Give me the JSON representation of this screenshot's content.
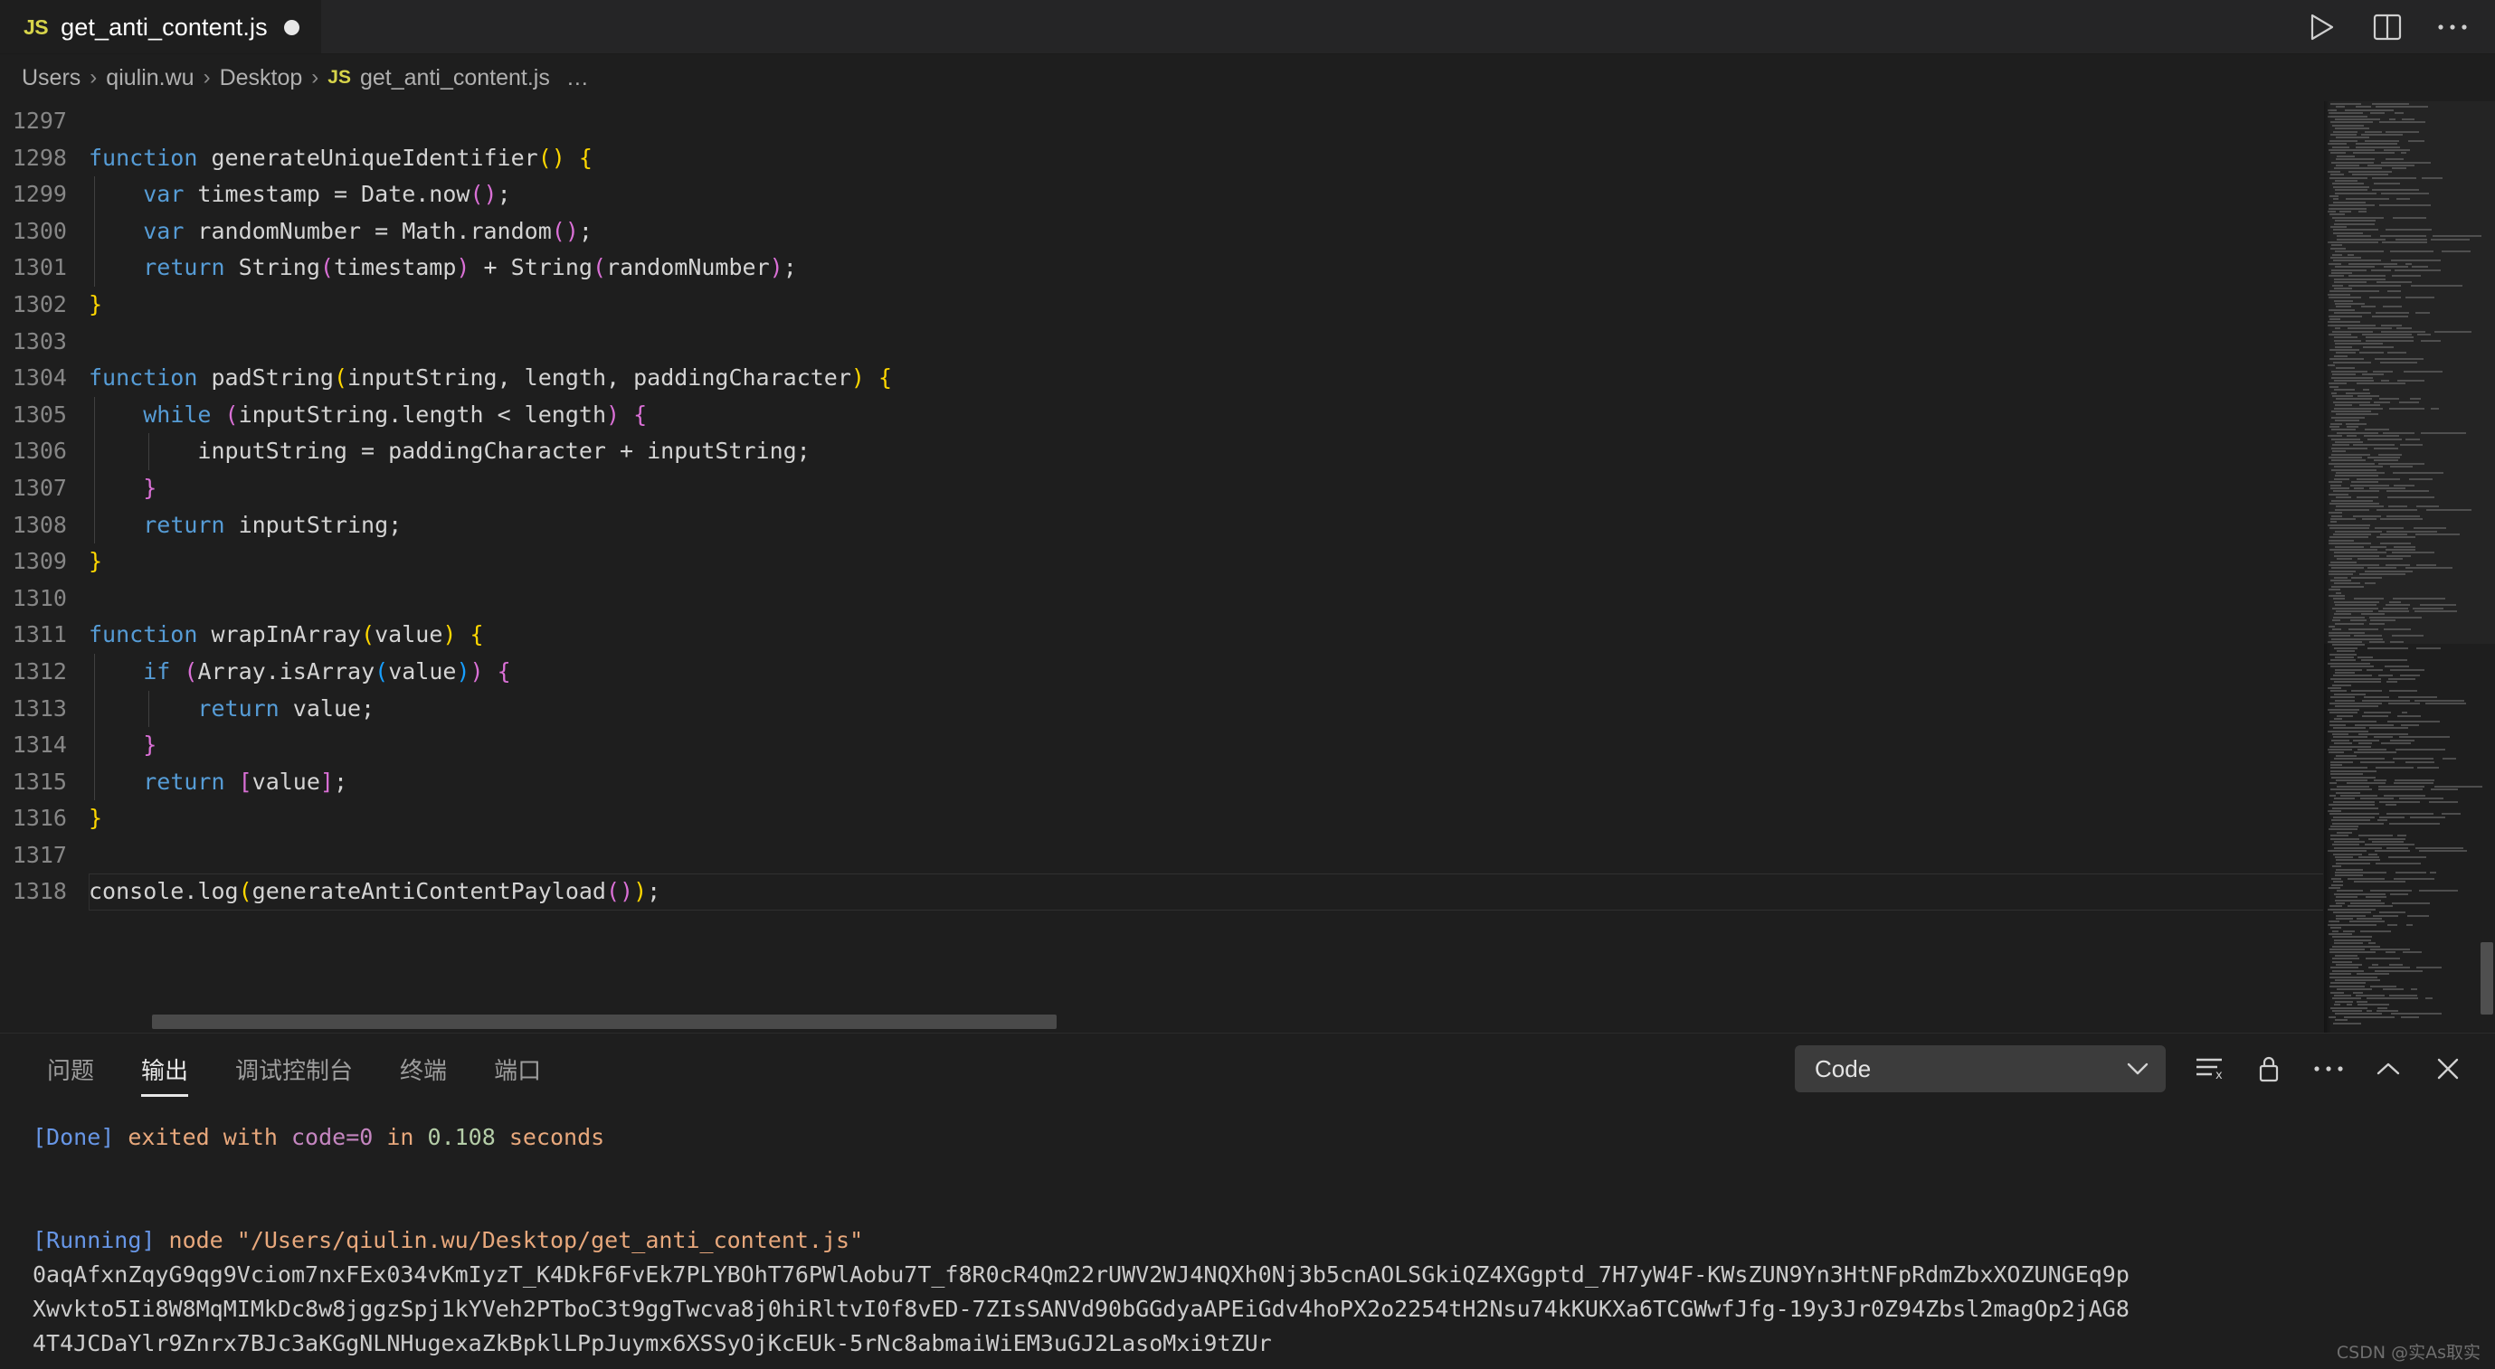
{
  "window": {
    "tab": {
      "icon": "js-file-icon",
      "label": "get_anti_content.js",
      "dirty_indicator": "●"
    },
    "actions": [
      {
        "name": "run-button",
        "glyph": "run-triangle-icon"
      },
      {
        "name": "split-editor-button",
        "glyph": "split-editor-icon"
      },
      {
        "name": "more-actions-button",
        "glyph": "ellipsis-icon"
      }
    ]
  },
  "breadcrumb": {
    "separator": "›",
    "items": [
      "Users",
      "qiulin.wu",
      "Desktop"
    ],
    "file": {
      "badge": "JS",
      "label": "get_anti_content.js"
    },
    "ellipsis": "…"
  },
  "editor": {
    "first_line_number": 1297,
    "current_line": 1318,
    "lines": [
      {
        "n": 1297,
        "tokens": []
      },
      {
        "n": 1298,
        "tokens": [
          {
            "t": "function",
            "c": "kw"
          },
          {
            "t": " ",
            "c": "punc"
          },
          {
            "t": "generateUniqueIdentifier",
            "c": "id"
          },
          {
            "t": "(",
            "c": "b1"
          },
          {
            "t": ")",
            "c": "b1"
          },
          {
            "t": " ",
            "c": "punc"
          },
          {
            "t": "{",
            "c": "b1"
          }
        ]
      },
      {
        "n": 1299,
        "indent": 1,
        "tokens": [
          {
            "t": "    ",
            "c": "punc"
          },
          {
            "t": "var",
            "c": "kw"
          },
          {
            "t": " timestamp = Date.now",
            "c": "id"
          },
          {
            "t": "(",
            "c": "b2"
          },
          {
            "t": ")",
            "c": "b2"
          },
          {
            "t": ";",
            "c": "punc"
          }
        ]
      },
      {
        "n": 1300,
        "indent": 1,
        "tokens": [
          {
            "t": "    ",
            "c": "punc"
          },
          {
            "t": "var",
            "c": "kw"
          },
          {
            "t": " randomNumber = Math.random",
            "c": "id"
          },
          {
            "t": "(",
            "c": "b2"
          },
          {
            "t": ")",
            "c": "b2"
          },
          {
            "t": ";",
            "c": "punc"
          }
        ]
      },
      {
        "n": 1301,
        "indent": 1,
        "tokens": [
          {
            "t": "    ",
            "c": "punc"
          },
          {
            "t": "return",
            "c": "kw"
          },
          {
            "t": " String",
            "c": "id"
          },
          {
            "t": "(",
            "c": "b2"
          },
          {
            "t": "timestamp",
            "c": "id"
          },
          {
            "t": ")",
            "c": "b2"
          },
          {
            "t": " + ",
            "c": "id"
          },
          {
            "t": "String",
            "c": "id"
          },
          {
            "t": "(",
            "c": "b2"
          },
          {
            "t": "randomNumber",
            "c": "id"
          },
          {
            "t": ")",
            "c": "b2"
          },
          {
            "t": ";",
            "c": "punc"
          }
        ]
      },
      {
        "n": 1302,
        "tokens": [
          {
            "t": "}",
            "c": "b1"
          }
        ]
      },
      {
        "n": 1303,
        "tokens": []
      },
      {
        "n": 1304,
        "tokens": [
          {
            "t": "function",
            "c": "kw"
          },
          {
            "t": " ",
            "c": "punc"
          },
          {
            "t": "padString",
            "c": "id"
          },
          {
            "t": "(",
            "c": "b1"
          },
          {
            "t": "inputString, length, paddingCharacter",
            "c": "id"
          },
          {
            "t": ")",
            "c": "b1"
          },
          {
            "t": " ",
            "c": "punc"
          },
          {
            "t": "{",
            "c": "b1"
          }
        ]
      },
      {
        "n": 1305,
        "indent": 1,
        "tokens": [
          {
            "t": "    ",
            "c": "punc"
          },
          {
            "t": "while",
            "c": "kw"
          },
          {
            "t": " ",
            "c": "punc"
          },
          {
            "t": "(",
            "c": "b2"
          },
          {
            "t": "inputString.length < length",
            "c": "id"
          },
          {
            "t": ")",
            "c": "b2"
          },
          {
            "t": " ",
            "c": "punc"
          },
          {
            "t": "{",
            "c": "b2"
          }
        ]
      },
      {
        "n": 1306,
        "indent": 2,
        "tokens": [
          {
            "t": "        inputString = paddingCharacter + inputString;",
            "c": "id"
          }
        ]
      },
      {
        "n": 1307,
        "indent": 1,
        "tokens": [
          {
            "t": "    ",
            "c": "punc"
          },
          {
            "t": "}",
            "c": "b2"
          }
        ]
      },
      {
        "n": 1308,
        "indent": 1,
        "tokens": [
          {
            "t": "    ",
            "c": "punc"
          },
          {
            "t": "return",
            "c": "kw"
          },
          {
            "t": " inputString;",
            "c": "id"
          }
        ]
      },
      {
        "n": 1309,
        "tokens": [
          {
            "t": "}",
            "c": "b1"
          }
        ]
      },
      {
        "n": 1310,
        "tokens": []
      },
      {
        "n": 1311,
        "tokens": [
          {
            "t": "function",
            "c": "kw"
          },
          {
            "t": " ",
            "c": "punc"
          },
          {
            "t": "wrapInArray",
            "c": "id"
          },
          {
            "t": "(",
            "c": "b1"
          },
          {
            "t": "value",
            "c": "id"
          },
          {
            "t": ")",
            "c": "b1"
          },
          {
            "t": " ",
            "c": "punc"
          },
          {
            "t": "{",
            "c": "b1"
          }
        ]
      },
      {
        "n": 1312,
        "indent": 1,
        "tokens": [
          {
            "t": "    ",
            "c": "punc"
          },
          {
            "t": "if",
            "c": "kw"
          },
          {
            "t": " ",
            "c": "punc"
          },
          {
            "t": "(",
            "c": "b2"
          },
          {
            "t": "Array.isArray",
            "c": "id"
          },
          {
            "t": "(",
            "c": "b3"
          },
          {
            "t": "value",
            "c": "id"
          },
          {
            "t": ")",
            "c": "b3"
          },
          {
            "t": ")",
            "c": "b2"
          },
          {
            "t": " ",
            "c": "punc"
          },
          {
            "t": "{",
            "c": "b2"
          }
        ]
      },
      {
        "n": 1313,
        "indent": 2,
        "tokens": [
          {
            "t": "        ",
            "c": "punc"
          },
          {
            "t": "return",
            "c": "kw"
          },
          {
            "t": " value;",
            "c": "id"
          }
        ]
      },
      {
        "n": 1314,
        "indent": 1,
        "tokens": [
          {
            "t": "    ",
            "c": "punc"
          },
          {
            "t": "}",
            "c": "b2"
          }
        ]
      },
      {
        "n": 1315,
        "indent": 1,
        "tokens": [
          {
            "t": "    ",
            "c": "punc"
          },
          {
            "t": "return",
            "c": "kw"
          },
          {
            "t": " ",
            "c": "punc"
          },
          {
            "t": "[",
            "c": "b2"
          },
          {
            "t": "value",
            "c": "id"
          },
          {
            "t": "]",
            "c": "b2"
          },
          {
            "t": ";",
            "c": "punc"
          }
        ]
      },
      {
        "n": 1316,
        "tokens": [
          {
            "t": "}",
            "c": "b1"
          }
        ]
      },
      {
        "n": 1317,
        "tokens": []
      },
      {
        "n": 1318,
        "current": true,
        "tokens": [
          {
            "t": "console.log",
            "c": "id"
          },
          {
            "t": "(",
            "c": "b1"
          },
          {
            "t": "generateAntiContentPayload",
            "c": "id"
          },
          {
            "t": "(",
            "c": "b2"
          },
          {
            "t": ")",
            "c": "b2"
          },
          {
            "t": ")",
            "c": "b1"
          },
          {
            "t": ";",
            "c": "punc"
          }
        ]
      }
    ]
  },
  "panel": {
    "tabs": [
      {
        "label": "问题",
        "active": false
      },
      {
        "label": "输出",
        "active": true
      },
      {
        "label": "调试控制台",
        "active": false
      },
      {
        "label": "终端",
        "active": false
      },
      {
        "label": "端口",
        "active": false
      }
    ],
    "channel_select": {
      "value": "Code",
      "chevron": "chevron-down-icon"
    },
    "actions": [
      {
        "name": "clear-output-button",
        "glyph": "clear-output-icon"
      },
      {
        "name": "lock-scroll-button",
        "glyph": "lock-icon"
      },
      {
        "name": "panel-more-button",
        "glyph": "ellipsis-icon"
      },
      {
        "name": "maximize-panel-button",
        "glyph": "chevron-up-icon"
      },
      {
        "name": "close-panel-button",
        "glyph": "close-icon"
      }
    ],
    "output": [
      {
        "type": "done",
        "segments": [
          {
            "t": "[Done]",
            "c": "c-tag"
          },
          {
            "t": " exited with ",
            "c": "c-text"
          },
          {
            "t": "code=0",
            "c": "c-mag"
          },
          {
            "t": " in ",
            "c": "c-text"
          },
          {
            "t": "0.108",
            "c": "c-green"
          },
          {
            "t": " seconds",
            "c": "c-text"
          }
        ]
      },
      {
        "type": "blank",
        "segments": []
      },
      {
        "type": "blank",
        "segments": []
      },
      {
        "type": "running",
        "segments": [
          {
            "t": "[Running]",
            "c": "c-tag"
          },
          {
            "t": " node \"/Users/qiulin.wu/Desktop/get_anti_content.js\"",
            "c": "c-text"
          }
        ]
      },
      {
        "type": "payload",
        "segments": [
          {
            "t": "0aqAfxnZqyG9qg9Vciom7nxFEx034vKmIyzT_K4DkF6FvEk7PLYBOhT76PWlAobu7T_f8R0cR4Qm22rUWV2WJ4NQXh0Nj3b5cnAOLSGkiQZ4XGgptd_7H7yW4F-KWsZUN9Yn3HtNFpRdmZbxXOZUNGEq9p",
            "c": "c-plain"
          }
        ]
      },
      {
        "type": "payload",
        "segments": [
          {
            "t": "Xwvkto5Ii8W8MqMIMkDc8w8jggzSpj1kYVeh2PTboC3t9ggTwcva8j0hiRltvI0f8vED-7ZIsSANVd90bGGdyaAPEiGdv4hoPX2o2254tH2Nsu74kKUKXa6TCGWwfJfg-19y3Jr0Z94Zbsl2magOp2jAG8",
            "c": "c-plain"
          }
        ]
      },
      {
        "type": "payload",
        "segments": [
          {
            "t": "4T4JCDaYlr9Znrx7BJc3aKGgNLNHugexaZkBpklLPpJuymx6XSSyOjKcEUk-5rNc8abmaiWiEM3uGJ2LasoMxi9tZUr",
            "c": "c-plain"
          }
        ]
      }
    ]
  },
  "watermark": "CSDN @实As取实",
  "colors": {
    "background": "#1e1e1e",
    "tabbar": "#252526",
    "keyword": "#569cd6",
    "identifier": "#d4d4d4",
    "bracket_level1": "#ffd700",
    "bracket_level2": "#da70d6",
    "bracket_level3": "#179fff",
    "js_badge": "#d7d44a",
    "output_tag": "#6796e6",
    "output_text": "#e8a87c",
    "output_magenta": "#c586c0",
    "output_green": "#b5cea8"
  }
}
